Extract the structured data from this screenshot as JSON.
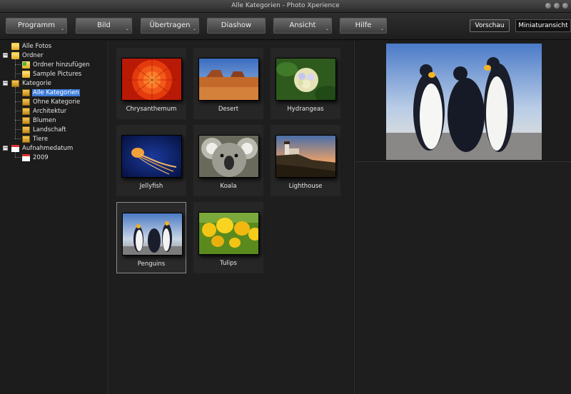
{
  "window": {
    "title": "Alle Kategorien - Photo Xperience"
  },
  "toolbar": {
    "menus": [
      {
        "label": "Programm",
        "has_dropdown": true
      },
      {
        "label": "Bild",
        "has_dropdown": true
      },
      {
        "label": "Übertragen",
        "has_dropdown": true
      },
      {
        "label": "Diashow",
        "has_dropdown": false
      },
      {
        "label": "Ansicht",
        "has_dropdown": true
      },
      {
        "label": "Hilfe",
        "has_dropdown": true
      }
    ],
    "dropdown_glyph": "⌄",
    "view_preview": "Vorschau",
    "view_thumbnails": "Miniaturansicht"
  },
  "sidebar": {
    "expander_minus": "−",
    "items": [
      {
        "label": "Alle Fotos",
        "icon": "folder-icon",
        "level": 0
      },
      {
        "label": "Ordner",
        "icon": "folder-icon",
        "level": 0,
        "expanded": true
      },
      {
        "label": "Ordner hinzufügen",
        "icon": "folder-add-icon",
        "level": 1
      },
      {
        "label": "Sample Pictures",
        "icon": "folder-icon",
        "level": 1
      },
      {
        "label": "Kategorie",
        "icon": "category-icon",
        "level": 0,
        "expanded": true
      },
      {
        "label": "Alle Kategorien",
        "icon": "category-icon",
        "level": 1,
        "selected": true
      },
      {
        "label": "Ohne Kategorie",
        "icon": "category-icon",
        "level": 1
      },
      {
        "label": "Architektur",
        "icon": "category-icon",
        "level": 1
      },
      {
        "label": "Blumen",
        "icon": "category-icon",
        "level": 1
      },
      {
        "label": "Landschaft",
        "icon": "category-icon",
        "level": 1
      },
      {
        "label": "Tiere",
        "icon": "category-icon",
        "level": 1
      },
      {
        "label": "Aufnahmedatum",
        "icon": "calendar-icon",
        "level": 0,
        "expanded": true
      },
      {
        "label": "2009",
        "icon": "calendar-icon",
        "level": 1
      }
    ]
  },
  "photos": [
    {
      "name": "Chrysanthemum",
      "selected": false
    },
    {
      "name": "Desert",
      "selected": false
    },
    {
      "name": "Hydrangeas",
      "selected": false
    },
    {
      "name": "Jellyfish",
      "selected": false
    },
    {
      "name": "Koala",
      "selected": false
    },
    {
      "name": "Lighthouse",
      "selected": false
    },
    {
      "name": "Penguins",
      "selected": true
    },
    {
      "name": "Tulips",
      "selected": false
    }
  ],
  "colors": {
    "selection": "#3d7bd9",
    "background": "#1e1e1e"
  }
}
